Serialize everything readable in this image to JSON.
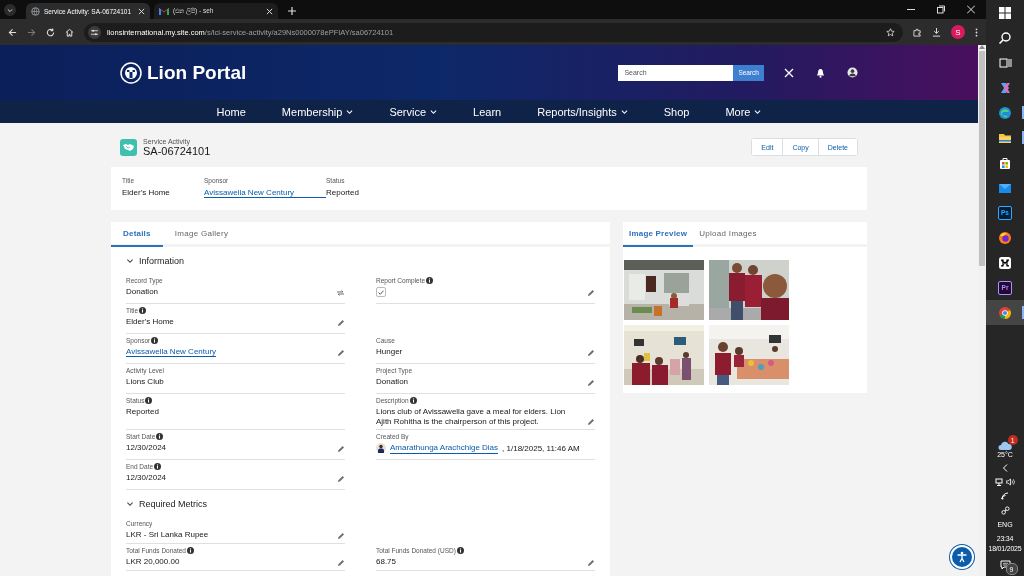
{
  "browser": {
    "tabs": [
      {
        "title": "Service Activity: SA-06724101",
        "kind": "page",
        "selected": true
      },
      {
        "title": "(එන ලිපි) - seh",
        "kind": "mail",
        "selected": false
      }
    ],
    "url_host": "lionsinternational.my.site.com",
    "url_path": "/s/lci-service-activity/a29Ns0000078ePFIAY/sa06724101",
    "profile_initial": "S"
  },
  "portal": {
    "logo": "Lion Portal",
    "search": {
      "placeholder": "Search",
      "button": "Search"
    },
    "nav": [
      {
        "label": "Home",
        "has_menu": false
      },
      {
        "label": "Membership",
        "has_menu": true
      },
      {
        "label": "Service",
        "has_menu": true
      },
      {
        "label": "Learn",
        "has_menu": false
      },
      {
        "label": "Reports/Insights",
        "has_menu": true
      },
      {
        "label": "Shop",
        "has_menu": false
      },
      {
        "label": "More",
        "has_menu": true
      }
    ]
  },
  "record": {
    "object": "Service Activity",
    "name": "SA-06724101",
    "actions": [
      "Edit",
      "Copy",
      "Delete"
    ],
    "highlights": [
      {
        "label": "Title",
        "value": "Elder's Home",
        "kind": "text"
      },
      {
        "label": "Sponsor",
        "value": "Avissawella New Century",
        "kind": "link"
      },
      {
        "label": "Status",
        "value": "Reported",
        "kind": "text"
      }
    ]
  },
  "detail_tabs": [
    {
      "label": "Details",
      "selected": true
    },
    {
      "label": "Image Gallery",
      "selected": false
    }
  ],
  "sections": [
    {
      "title": "Information",
      "expanded": true,
      "rows": [
        {
          "left": {
            "label": "Record Type",
            "info": false,
            "kind": "text",
            "value": "Donation",
            "editable": false,
            "type_changeable": true
          },
          "right": {
            "label": "Report Complete",
            "info": true,
            "kind": "checkbox",
            "checked": true,
            "editable": true
          }
        },
        {
          "left": {
            "label": "Title",
            "info": true,
            "kind": "text",
            "value": "Elder's Home",
            "editable": true
          }
        },
        {
          "left": {
            "label": "Sponsor",
            "info": true,
            "kind": "link",
            "value": "Avissawella New Century",
            "editable": true
          },
          "right": {
            "label": "Cause",
            "info": false,
            "kind": "text",
            "value": "Hunger",
            "editable": true
          }
        },
        {
          "left": {
            "label": "Activity Level",
            "info": false,
            "kind": "text",
            "value": "Lions Club",
            "editable": false
          },
          "right": {
            "label": "Project Type",
            "info": false,
            "kind": "text",
            "value": "Donation",
            "editable": true
          }
        },
        {
          "left": {
            "label": "Status",
            "info": true,
            "kind": "text",
            "value": "Reported",
            "editable": false
          },
          "right": {
            "label": "Description",
            "info": true,
            "kind": "text",
            "value": "Lions club of Avissawella gave a meal for elders. Lion Ajith Rohitha is the chairperson of this project.",
            "editable": true
          }
        },
        {
          "left": {
            "label": "Start Date",
            "info": true,
            "kind": "text",
            "value": "12/30/2024",
            "editable": true
          },
          "right": {
            "label": "Created By",
            "info": false,
            "kind": "user",
            "value": "Amarathunga Arachchige Dias",
            "suffix": ", 1/18/2025, 11:46 AM",
            "editable": false
          }
        },
        {
          "left": {
            "label": "End Date",
            "info": true,
            "kind": "text",
            "value": "12/30/2024",
            "editable": true
          }
        }
      ]
    },
    {
      "title": "Required Metrics",
      "expanded": true,
      "rows": [
        {
          "left": {
            "label": "Currency",
            "info": false,
            "kind": "text",
            "value": "LKR - Sri Lanka Rupee",
            "editable": true
          }
        },
        {
          "left": {
            "label": "Total Funds Donated",
            "info": true,
            "kind": "text",
            "value": "LKR 20,000.00",
            "editable": true
          },
          "right": {
            "label": "Total Funds Donated (USD)",
            "info": true,
            "kind": "text",
            "value": "68.75",
            "editable": true
          }
        }
      ]
    }
  ],
  "image_tabs": [
    {
      "label": "Image Preview",
      "selected": true
    },
    {
      "label": "Upload Images",
      "selected": false
    }
  ],
  "taskbar": {
    "apps": [
      {
        "kind": "start"
      },
      {
        "kind": "search"
      },
      {
        "kind": "taskview"
      },
      {
        "kind": "copilot"
      },
      {
        "kind": "edge",
        "running": true
      },
      {
        "kind": "explorer",
        "running": true
      },
      {
        "kind": "store"
      },
      {
        "kind": "mail"
      },
      {
        "kind": "photoshop",
        "label": "Ps"
      },
      {
        "kind": "firefox"
      },
      {
        "kind": "capcut"
      },
      {
        "kind": "premiere",
        "label": "Pr"
      },
      {
        "kind": "chrome",
        "running": true,
        "selected": true
      }
    ],
    "weather_badge": "1",
    "temperature": "25°C",
    "language": "ENG",
    "time": "23:34",
    "date": "18/01/2025",
    "notifications": "9"
  }
}
